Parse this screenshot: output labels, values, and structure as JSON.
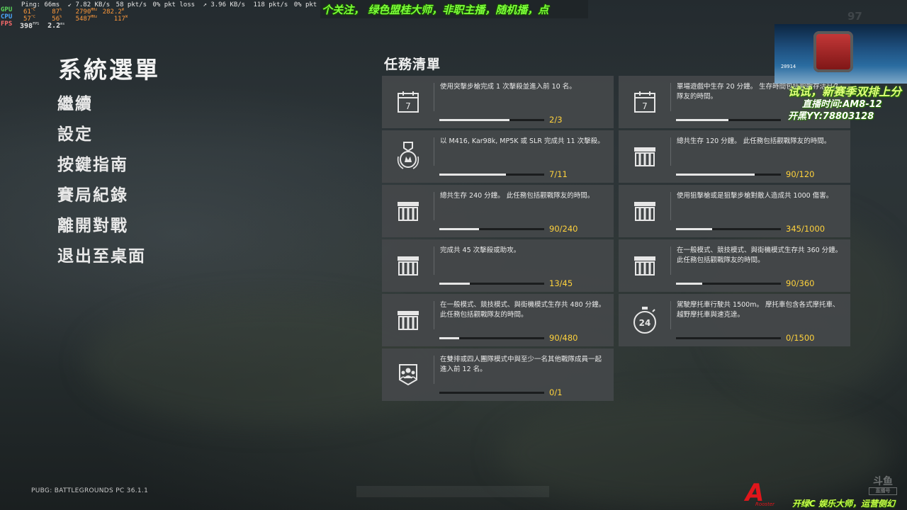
{
  "hud": {
    "ping": "Ping: 66ms",
    "net_down": "7.82 KB/s",
    "net_pkts_down": "58 pkt/s",
    "net_loss_down": "0% pkt loss",
    "net_up": "3.96 KB/s",
    "net_pkts_up": "118 pkt/s",
    "net_loss_up": "0% pkt loss",
    "gpu_label": "GPU",
    "gpu_temp": "61",
    "gpu_temp_unit": "°C",
    "gpu_load": "87",
    "gpu_load_unit": "%",
    "gpu_clock": "2790",
    "gpu_clock_unit": "MHz",
    "gpu_power": "282.2",
    "gpu_power_unit": "W",
    "cpu_label": "CPU",
    "cpu_temp": "57",
    "cpu_temp_unit": "°C",
    "cpu_load": "56",
    "cpu_load_unit": "%",
    "cpu_clock": "5487",
    "cpu_clock_unit": "MHz",
    "cpu_power": "117",
    "cpu_power_unit": "W",
    "fps_label": "FPS",
    "fps_value": "398",
    "fps_unit": "FPS",
    "frametime_value": "2.2",
    "frametime_unit": "ms"
  },
  "system_menu": {
    "title": "系統選單",
    "items": [
      "繼續",
      "設定",
      "按鍵指南",
      "賽局紀錄",
      "離開對戰",
      "退出至桌面"
    ]
  },
  "missions": {
    "title": "任務清單",
    "items": [
      {
        "icon": "calendar-icon",
        "calendar_day": "7",
        "text": "使用突擊步槍完成 1 次擊殺並進入前 10 名。",
        "progress": "2/3",
        "ratio": 0.667
      },
      {
        "icon": "calendar-icon",
        "calendar_day": "7",
        "text": "單場遊戲中生存 20 分鐘。 生存時間包括觀戰存活且久隊友的時間。",
        "progress": "",
        "ratio": 0.5
      },
      {
        "icon": "medal-icon",
        "text": "以 M416, Kar98k, MP5K 或 SLR 完成共 11 次擊殺。",
        "progress": "7/11",
        "ratio": 0.636
      },
      {
        "icon": "crate-icon",
        "text": "總共生存 120 分鐘。 此任務包括觀戰隊友的時間。",
        "progress": "90/120",
        "ratio": 0.75
      },
      {
        "icon": "crate-icon",
        "text": "總共生存 240 分鐘。 此任務包括觀戰隊友的時間。",
        "progress": "90/240",
        "ratio": 0.375
      },
      {
        "icon": "crate-icon",
        "text": "使用狙擊槍或是狙擊步槍對敵人造成共 1000 傷害。",
        "progress": "345/1000",
        "ratio": 0.345
      },
      {
        "icon": "crate-icon",
        "text": "完成共 45 次擊殺或助攻。",
        "progress": "13/45",
        "ratio": 0.289
      },
      {
        "icon": "crate-icon",
        "text": "在一般模式、競技模式、與街機模式生存共 360 分鐘。 此任務包括觀戰隊友的時間。",
        "progress": "90/360",
        "ratio": 0.25
      },
      {
        "icon": "crate-icon",
        "text": "在一般模式、競技模式、與街機模式生存共 480 分鐘。 此任務包括觀戰隊友的時間。",
        "progress": "90/480",
        "ratio": 0.1875
      },
      {
        "icon": "stopwatch-icon",
        "stopwatch_value": "24",
        "text": "駕駛摩托車行駛共 1500m。 摩托車包含各式摩托車、越野摩托車與速克達。",
        "progress": "0/1500",
        "ratio": 0
      },
      {
        "icon": "squad-icon",
        "text": "在雙排或四人團隊模式中與至少一名其他戰隊成員一起進入前 12 名。",
        "progress": "0/1",
        "ratio": 0
      }
    ]
  },
  "version": "PUBG: BATTLEGROUNDS PC 36.1.1",
  "stream": {
    "banner": "个关注， 绿色盟桂大师，非职主播，随机播，点",
    "side_line1": "试试，新赛季双排上分",
    "side_line2": "直播时间:AM8-12",
    "side_line3": "开黑YY:78803128",
    "bottom_text": "开绿C 娱乐大师，运营侧幻",
    "bottom_tag": "Rooster",
    "cam_altitude": "20914",
    "watermark": "斗鱼",
    "watermark_sub": "直播号",
    "sky_number": "97"
  },
  "colors": {
    "count_yellow": "#ffd23c",
    "card_bg": "#44484a",
    "bar_fill": "#e6e6e6"
  }
}
